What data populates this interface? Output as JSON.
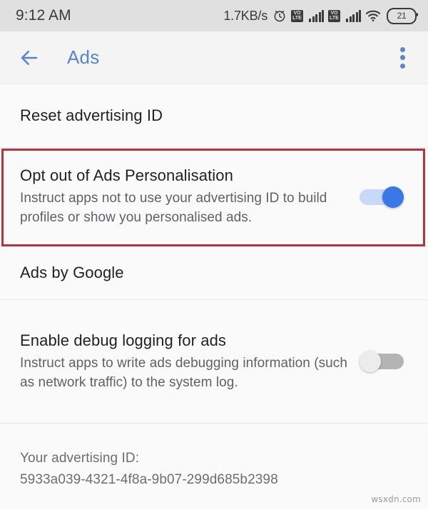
{
  "status_bar": {
    "clock": "9:12 AM",
    "network_speed": "1.7KB/s",
    "alarm_icon": "alarm-clock-icon",
    "sim1_volte_line1": "VO",
    "sim1_volte_line2": "LTE",
    "sim2_volte_line1": "VO",
    "sim2_volte_line2": "LTE",
    "wifi_icon": "wifi-icon",
    "battery_level": "21"
  },
  "app_bar": {
    "back_label": "back-arrow",
    "title": "Ads",
    "overflow_label": "more-options",
    "accent_color": "#5186d6"
  },
  "settings": {
    "rows": [
      {
        "title": "Reset advertising ID",
        "subtitle": "",
        "toggle": null
      },
      {
        "title": "Opt out of Ads Personalisation",
        "subtitle": "Instruct apps not to use your advertising ID to build profiles or show you personalised ads.",
        "toggle": "on"
      },
      {
        "title": "Ads by Google",
        "subtitle": "",
        "toggle": null
      },
      {
        "title": "Enable debug logging for ads",
        "subtitle": "Instruct apps to write ads debugging information (such as network traffic) to the system log.",
        "toggle": "off"
      }
    ]
  },
  "advertising_id": {
    "label": "Your advertising ID:",
    "value": "5933a039-4321-4f8a-9b07-299d685b2398"
  },
  "highlight": {
    "color": "#b5333c",
    "target": "Opt out of Ads Personalisation"
  },
  "watermark": "wsxdn.com"
}
